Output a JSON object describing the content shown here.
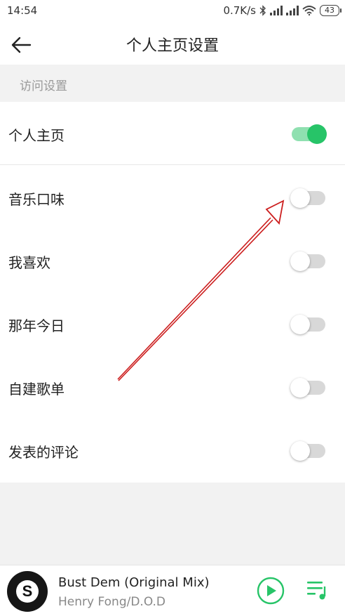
{
  "status_bar": {
    "time": "14:54",
    "network_speed": "0.7K/s",
    "battery": "43",
    "icons": [
      "bluetooth-icon",
      "signal-icon",
      "signal-icon",
      "wifi-icon",
      "battery-icon"
    ]
  },
  "header": {
    "title": "个人主页设置",
    "back_icon": "back-arrow-icon"
  },
  "section": {
    "title": "访问设置"
  },
  "settings": [
    {
      "label": "个人主页",
      "enabled": true
    },
    {
      "label": "音乐口味",
      "enabled": false
    },
    {
      "label": "我喜欢",
      "enabled": false
    },
    {
      "label": "那年今日",
      "enabled": false
    },
    {
      "label": "自建歌单",
      "enabled": false
    },
    {
      "label": "发表的评论",
      "enabled": false
    }
  ],
  "colors": {
    "accent_green": "#27c468",
    "track_on": "#8fe0b0",
    "track_off": "#d8d8d8",
    "annotation_red": "#cc1f1f"
  },
  "player": {
    "song": "Bust Dem (Original Mix)",
    "artist": "Henry Fong/D.O.D",
    "cover_icon": "album-cover-icon",
    "play_icon": "play-icon",
    "playlist_icon": "playlist-icon"
  }
}
